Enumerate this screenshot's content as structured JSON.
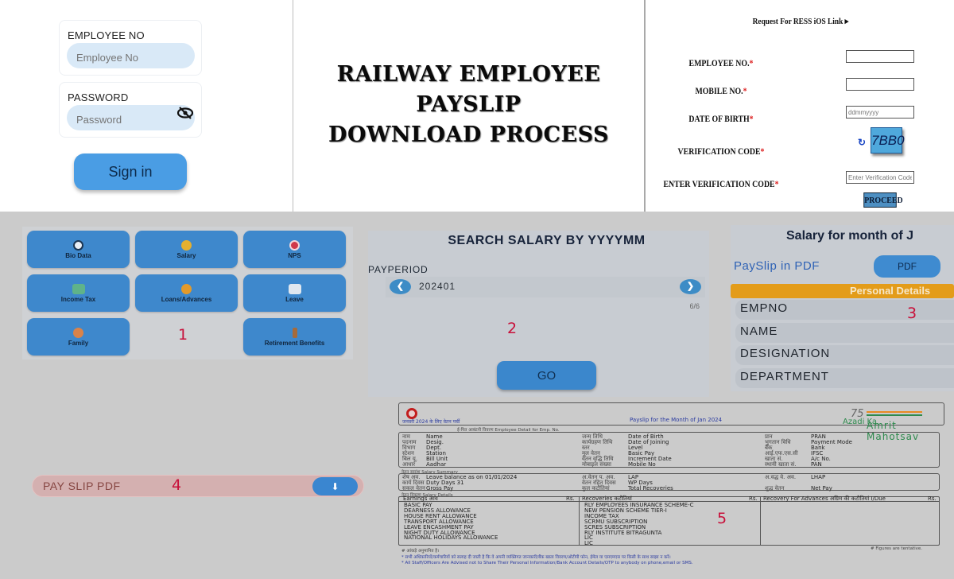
{
  "login": {
    "employee_label": "EMPLOYEE NO",
    "employee_placeholder": "Employee No",
    "password_label": "PASSWORD",
    "password_placeholder": "Password",
    "signin_label": "Sign in"
  },
  "title": {
    "line1": "RAILWAY EMPLOYEE",
    "line2": "PAYSLIP",
    "line3": "DOWNLOAD PROCESS"
  },
  "ress_form": {
    "heading": "Request For RESS iOS Link ▸",
    "fields": [
      {
        "label": "EMPLOYEE NO.",
        "placeholder": ""
      },
      {
        "label": "MOBILE NO.",
        "placeholder": ""
      },
      {
        "label": "DATE OF BIRTH",
        "placeholder": "ddmmyyyy"
      },
      {
        "label": "VERIFICATION CODE",
        "placeholder": ""
      },
      {
        "label": "ENTER VERIFICATION CODE",
        "placeholder": "Enter Verification Code"
      }
    ],
    "required_mark": "*",
    "captcha": "7BB0",
    "refresh_icon": "↻",
    "proceed_label": "PROCEED"
  },
  "menu": {
    "tiles": [
      {
        "label": "Bio Data",
        "icon": "user-icon",
        "color": "#e8eef5"
      },
      {
        "label": "Salary",
        "icon": "coin-icon",
        "color": "#e6b02e"
      },
      {
        "label": "NPS",
        "icon": "piggy-bank-icon",
        "color": "#d0394a"
      },
      {
        "label": "Income Tax",
        "icon": "money-icon",
        "color": "#5fb38a"
      },
      {
        "label": "Loans/Advances",
        "icon": "house-icon",
        "color": "#e39a2a"
      },
      {
        "label": "Leave",
        "icon": "calendar-icon",
        "color": "#dfe7ef"
      },
      {
        "label": "Family",
        "icon": "family-icon",
        "color": "#d9834a"
      },
      {
        "label": "Retirement Benefits",
        "icon": "elderly-icon",
        "color": "#a56b3c"
      }
    ]
  },
  "markers": {
    "m1": "1",
    "m2": "2",
    "m3": "3",
    "m4": "4",
    "m5": "5"
  },
  "search": {
    "heading": "SEARCH SALARY BY YYYYMM",
    "period_label": "PAYPERIOD",
    "period_value": "202401",
    "prev_icon": "❮",
    "next_icon": "❯",
    "counter": "6/6",
    "go_label": "GO"
  },
  "salary": {
    "heading": "Salary for month of  J",
    "payslip_label": "PaySlip in PDF",
    "pdf_button": "PDF",
    "section_header": "Personal Details",
    "rows": [
      "EMPNO",
      "NAME",
      "DESIGNATION",
      "DEPARTMENT"
    ]
  },
  "pdf_download": {
    "label": "PAY SLIP PDF",
    "icon": "⬇"
  },
  "payslip": {
    "hindi_header": "जनवरी 2024  के लिए वेतन पर्ची",
    "title": "Payslip for the Month of Jan 2024",
    "azadi_l1": "75",
    "azadi_l2": "Azadi Ka",
    "azadi_l3": "Amrit Mahotsav",
    "employee_detail_caption": "ई-पित आबंटनी विवरण        Employee Detail for Emp. No.",
    "detail_col1_hi": [
      "नाम",
      "पदनाम",
      "विभाग",
      "स्टेशन",
      "बिल यू.",
      "आधार"
    ],
    "detail_col1": [
      "Name",
      "Desig.",
      "Dept.",
      "Station",
      "Bill Unit",
      "Aadhar"
    ],
    "detail_col2_hi": [
      "जन्म तिथि",
      "कार्यग्रहण तिथि",
      "स्तर",
      "मूल वेतन",
      "वेतन वृद्धि तिथि",
      "मोबाइल संख्या"
    ],
    "detail_col2": [
      "Date of Birth",
      "Date of Joining",
      "Level",
      "Basic Pay",
      "Increment Date",
      "Mobile No"
    ],
    "detail_col3_hi": [
      "प्रान",
      "भुगतान विधि",
      "बैंक",
      "आई.एफ.एस.सी",
      "खाता सं.",
      "स्थायी खाता सं."
    ],
    "detail_col3": [
      "PRAN",
      "Payment Mode",
      "Bank",
      "IFSC",
      "A/c No.",
      "PAN"
    ],
    "summary_caption": "वेतन सारांश        Salary Summary",
    "summary_col1_hi": [
      "शेष अव.",
      "कार्य दिवस",
      "सकल वेतन"
    ],
    "summary_col1": [
      "Leave balance as on 01/01/2024",
      "Duty Days   31",
      "Gross Pay"
    ],
    "summary_col2_hi": [
      "अ.वेतन प. अव.",
      "वेतन रहित दिवस",
      "कुल कटौतियां"
    ],
    "summary_col2": [
      "LAP",
      "WP Days",
      "Total Recoveries"
    ],
    "summary_col3_hi": [
      "अ.वद्ध वे. अव.",
      "शुद्ध वेतन"
    ],
    "summary_col3": [
      "LHAP",
      "Net Pay"
    ],
    "details_caption": "वेतन विवरण        Salary Details",
    "earnings_header": "Earnings आय",
    "recoveries_header": "Recoveries कटौतियां",
    "advances_header": "Recovery For Advances अग्रिम की कटौतियां     I/Due",
    "rs": "Rs.",
    "earnings": [
      "BASIC PAY",
      "DEARNESS ALLOWANCE",
      "HOUSE RENT ALLOWANCE",
      "TRANSPORT ALLOWANCE",
      "LEAVE ENCASHMENT PAY",
      "NIGHT DUTY ALLOWANCE",
      "NATIONAL HOLIDAYS ALLOWANCE"
    ],
    "recoveries": [
      "RLY EMPLOYEES INSURANCE SCHEME-C",
      "NEW PENSION SCHEME TIER-I",
      "INCOME TAX",
      "SCRMU SUBSCRIPTION",
      "SCRES SUBSCRIPTION",
      "RLY INSTITUTE BITRAGUNTA",
      "LIC",
      "LIC"
    ],
    "note_tentative_hi": "# आंकड़े अनुमानित है।",
    "note_tentative": "# Figures are tentative.",
    "note_hi": "*  सभी अधिकारियों/कर्मचारियों को सलाह दी जाती है कि वे अपनी व्यक्तिगत जानकारी/बैंक खाता विवरण/ओटीपी फोन, ईमेल या एसएमएस पर किसी के साथ साझा न करें।",
    "note_en": "*  All Staff/Officers Are Advised not to Share Their Personal Information/Bank Account Details/OTP to anybody on phone,email or SMS."
  }
}
